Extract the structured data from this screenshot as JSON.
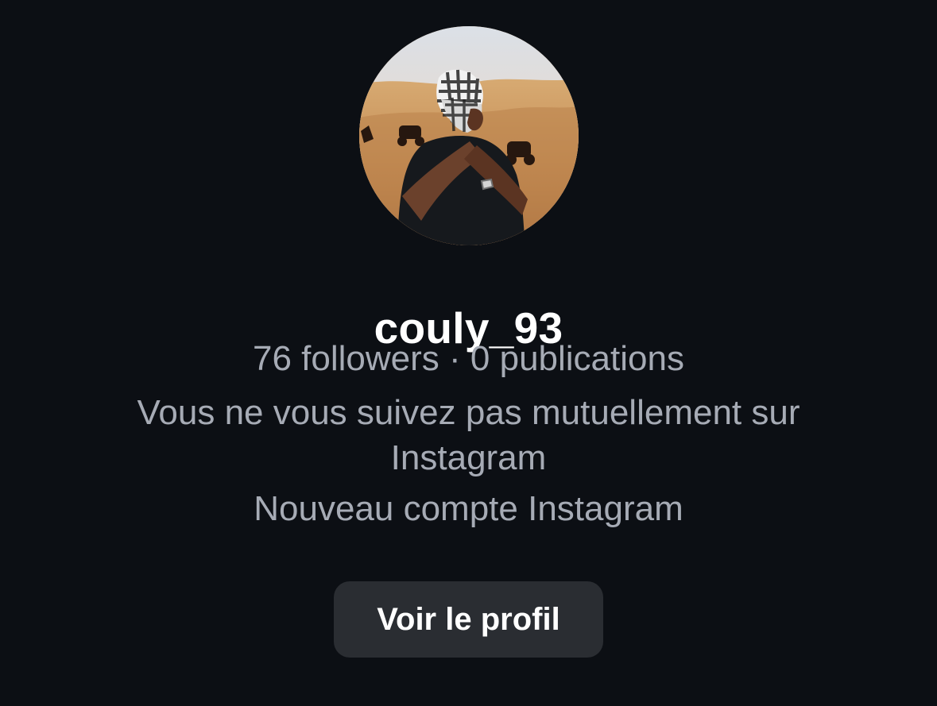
{
  "profile": {
    "username": "couly_93",
    "stats": "76 followers · 0 publications",
    "mutual_follow_note": "Vous ne vous suivez pas mutuellement sur Instagram",
    "account_note": "Nouveau compte Instagram",
    "view_profile_label": "Voir le profil",
    "avatar_icon": "profile-photo"
  },
  "colors": {
    "background": "#0c0f14",
    "primary_text": "#ffffff",
    "secondary_text": "#a6abb5",
    "button_background": "#2a2d32"
  }
}
